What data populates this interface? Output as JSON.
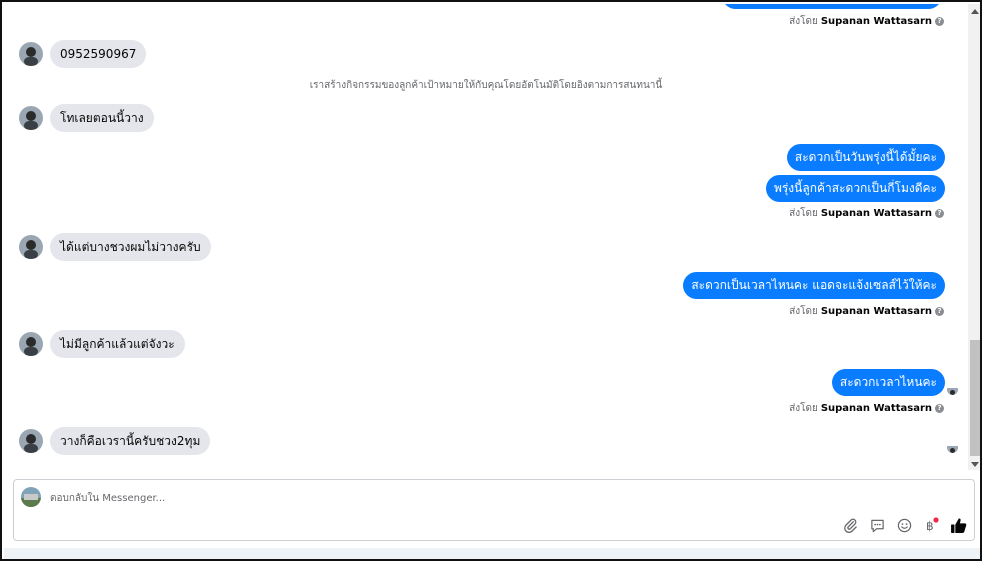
{
  "conversation": {
    "system_note": "เราสร้างกิจกรรมของลูกค้าเป้าหมายให้กับคุณโดยอัตโนมัติโดยอิงตามการสนทนานี้",
    "sent_by_prefix": "ส่งโดย",
    "agent_name": "Supanan Wattasarn",
    "help_glyph": "?",
    "incoming": [
      {
        "text": "0952590967"
      },
      {
        "text": "โทเลยตอนนี้วาง"
      },
      {
        "text": "ได้แต่บางชวงผมไม่วางครับ"
      },
      {
        "text": "ไม่มีลูกค้าแล้วแต่จังวะ"
      },
      {
        "text": "วางก็คือเวรานี้ครับชวง2ทุม"
      }
    ],
    "outgoing": [
      {
        "text": "สะดวกเป็นวันพรุ่งนี้ได้มั้ยคะ"
      },
      {
        "text": "พรุ่งนี้ลูกค้าสะดวกเป็นกี่โมงดีคะ"
      },
      {
        "text": "สะดวกเป็นเวลาไหนคะ แอดจะแจ้งเซลส์ไว้ให้คะ"
      },
      {
        "text": "สะดวกเวลาไหนคะ"
      }
    ]
  },
  "composer": {
    "placeholder": "ตอบกลับใน Messenger...",
    "value": "",
    "tools": [
      "attachment-icon",
      "saved-replies-icon",
      "emoji-icon",
      "payment-icon",
      "like-icon"
    ]
  },
  "colors": {
    "outgoing_bubble": "#0a7cff",
    "incoming_bubble": "#e4e6eb",
    "secondary_text": "#65676b",
    "notification_dot": "#f02849"
  }
}
